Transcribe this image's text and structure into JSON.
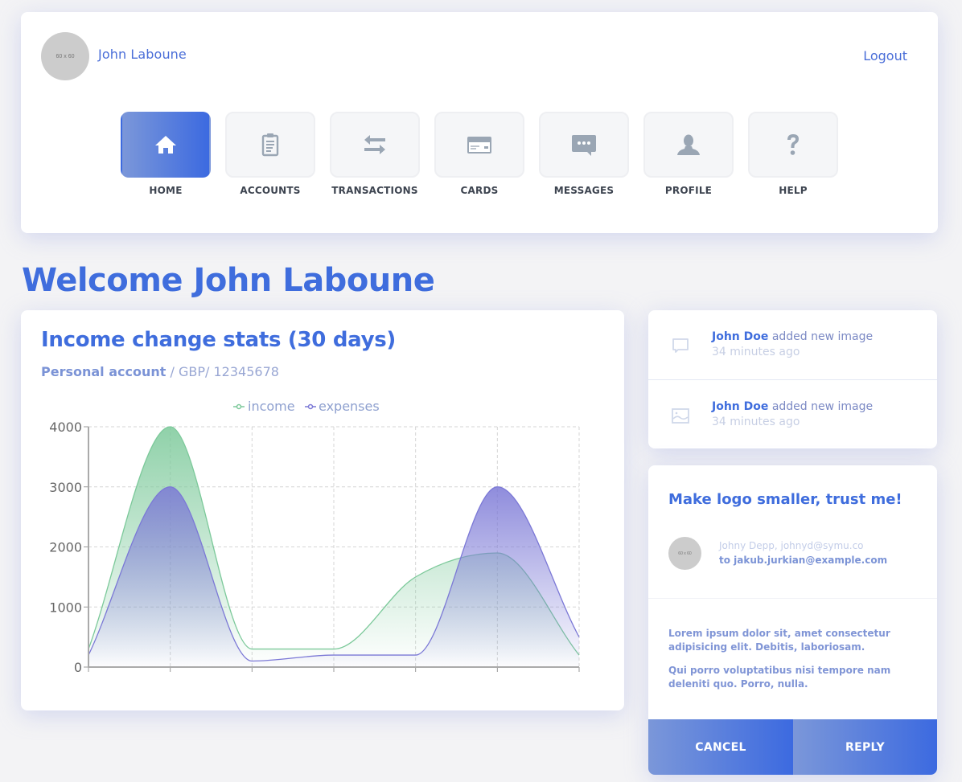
{
  "header": {
    "avatar_placeholder": "60 x 60",
    "user_name": "John Laboune",
    "logout_label": "Logout"
  },
  "nav": {
    "items": [
      {
        "label": "HOME",
        "icon": "home-icon",
        "active": true
      },
      {
        "label": "ACCOUNTS",
        "icon": "clipboard-icon",
        "active": false
      },
      {
        "label": "TRANSACTIONS",
        "icon": "arrows-exchange-icon",
        "active": false
      },
      {
        "label": "CARDS",
        "icon": "credit-card-icon",
        "active": false
      },
      {
        "label": "MESSAGES",
        "icon": "chat-bubble-icon",
        "active": false
      },
      {
        "label": "PROFILE",
        "icon": "user-icon",
        "active": false
      },
      {
        "label": "HELP",
        "icon": "question-icon",
        "active": false
      }
    ]
  },
  "welcome": {
    "title": "Welcome John Laboune"
  },
  "chart_card": {
    "title": "Income change stats (30 days)",
    "account_label": "Personal account",
    "account_details": " / GBP/ 12345678"
  },
  "chart_data": {
    "type": "area",
    "title": "Income change stats (30 days)",
    "xlabel": "",
    "ylabel": "",
    "x": [
      0,
      1,
      2,
      3,
      4,
      5,
      6
    ],
    "ylim": [
      0,
      4000
    ],
    "yticks": [
      0,
      1000,
      2000,
      3000,
      4000
    ],
    "grid": true,
    "legend_position": "top-center",
    "series": [
      {
        "name": "income",
        "color": "#7cc99a",
        "values": [
          300,
          4000,
          300,
          300,
          1500,
          1900,
          200
        ]
      },
      {
        "name": "expenses",
        "color": "#7b78d6",
        "values": [
          200,
          3000,
          100,
          200,
          200,
          3000,
          500
        ]
      }
    ]
  },
  "activity": {
    "items": [
      {
        "icon": "comment-icon",
        "actor": "John Doe",
        "action": " added new image",
        "time": "34 minutes ago"
      },
      {
        "icon": "image-icon",
        "actor": "John Doe",
        "action": " added new image",
        "time": "34 minutes ago"
      }
    ]
  },
  "message": {
    "title": "Make logo smaller, trust me!",
    "avatar_placeholder": "60 x 60",
    "from": "Johny Depp, johnyd@symu.co",
    "to": "to jakub.jurkian@example.com",
    "body": [
      "Lorem ipsum dolor sit, amet consectetur adipisicing elit. Debitis, laboriosam.",
      "Qui porro voluptatibus nisi tempore nam deleniti quo. Porro, nulla."
    ],
    "cancel_label": "CANCEL",
    "reply_label": "REPLY"
  },
  "colors": {
    "accent": "#3f6ddd",
    "income": "#7cc99a",
    "expenses": "#7b78d6"
  }
}
